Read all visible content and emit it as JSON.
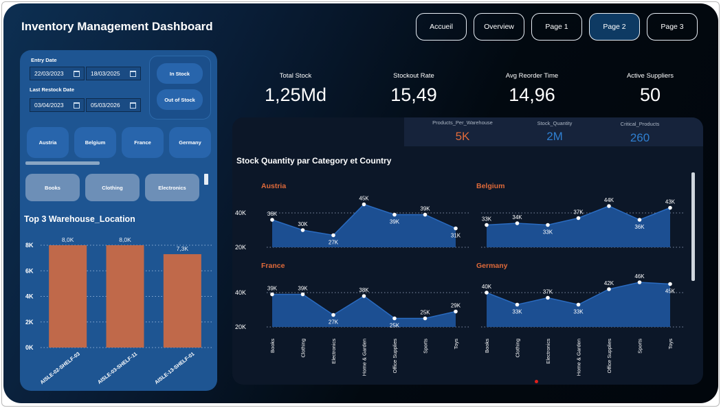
{
  "header": {
    "title": "Inventory Management Dashboard"
  },
  "nav": [
    {
      "label": "Accueil",
      "active": false
    },
    {
      "label": "Overview",
      "active": false
    },
    {
      "label": "Page 1",
      "active": false
    },
    {
      "label": "Page 2",
      "active": true
    },
    {
      "label": "Page 3",
      "active": false
    }
  ],
  "filters": {
    "entry_date": {
      "label": "Entry Date",
      "from": "22/03/2023",
      "to": "18/03/2025"
    },
    "last_restock_date": {
      "label": "Last Restock Date",
      "from": "03/04/2023",
      "to": "05/03/2026"
    },
    "stock_buttons": [
      "In Stock",
      "Out of Stock"
    ],
    "countries": [
      "Austria",
      "Belgium",
      "France",
      "Germany"
    ],
    "categories": [
      "Books",
      "Clothing",
      "Electronics"
    ]
  },
  "kpis": [
    {
      "label": "Total Stock",
      "value": "1,25Md"
    },
    {
      "label": "Stockout Rate",
      "value": "15,49"
    },
    {
      "label": "Avg Reorder Time",
      "value": "14,96"
    },
    {
      "label": "Active Suppliers",
      "value": "50"
    }
  ],
  "sub_kpis": [
    {
      "label": "Products_Per_Warehouse",
      "value": "5K",
      "color": "#e06a3a"
    },
    {
      "label": "Stock_Quantity",
      "value": "2M",
      "color": "#2f7fd0"
    },
    {
      "label": "Critical_Products",
      "value": "260",
      "color": "#2f7fd0"
    }
  ],
  "colors": {
    "bar": "#c0694a",
    "area": "#1c4f92",
    "country_label": "#e06a3a"
  },
  "chart_data": [
    {
      "type": "bar",
      "title": "Top 3 Warehouse_Location",
      "categories": [
        "AISLE-02-SHELF-03",
        "AISLE-03-SHELF-11",
        "AISLE-13-SHELF-01"
      ],
      "values": [
        8000,
        8000,
        7300
      ],
      "data_labels": [
        "8,0K",
        "8,0K",
        "7,3K"
      ],
      "ylim": [
        0,
        8000
      ],
      "y_ticks": [
        "0K",
        "2K",
        "4K",
        "6K",
        "8K"
      ],
      "y_tick_values": [
        0,
        2000,
        4000,
        6000,
        8000
      ],
      "grid": true
    },
    {
      "type": "area",
      "title": "Stock Quantity par Category et Country",
      "categories": [
        "Books",
        "Clothing",
        "Electronics",
        "Home & Garden",
        "Office Supplies",
        "Sports",
        "Toys"
      ],
      "ylim": [
        20000,
        50000
      ],
      "y_ticks": [
        "20K",
        "40K"
      ],
      "y_tick_values": [
        20000,
        40000
      ],
      "grid": true,
      "series": [
        {
          "name": "Austria",
          "values": [
            36000,
            30000,
            27000,
            45000,
            39000,
            39000,
            31000
          ],
          "labels": [
            "36K",
            "30K",
            "27K",
            "45K",
            "39K",
            "39K",
            "31K"
          ]
        },
        {
          "name": "Belgium",
          "values": [
            33000,
            34000,
            33000,
            37000,
            44000,
            36000,
            43000
          ],
          "labels": [
            "33K",
            "34K",
            "33K",
            "37K",
            "44K",
            "36K",
            "43K"
          ]
        },
        {
          "name": "France",
          "values": [
            39000,
            39000,
            27000,
            38000,
            25000,
            25000,
            29000
          ],
          "labels": [
            "39K",
            "39K",
            "27K",
            "38K",
            "25K",
            "25K",
            "29K"
          ]
        },
        {
          "name": "Germany",
          "values": [
            40000,
            33000,
            37000,
            33000,
            42000,
            46000,
            45000
          ],
          "labels": [
            "40K",
            "33K",
            "37K",
            "33K",
            "42K",
            "46K",
            "45K"
          ]
        }
      ]
    }
  ]
}
